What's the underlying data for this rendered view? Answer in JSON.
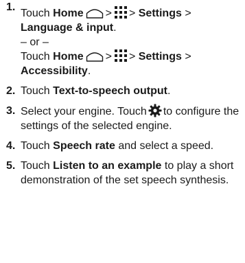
{
  "steps": [
    {
      "number": "1.",
      "touch": "Touch",
      "home": "Home",
      "sep1": ">",
      "sep2": ">",
      "settings": "Settings",
      "sep3": ">",
      "target": "Language & input",
      "end": ".",
      "or_text": "– or –",
      "alt_touch": "Touch",
      "alt_home": "Home",
      "alt_sep1": ">",
      "alt_sep2": ">",
      "alt_settings": "Settings",
      "alt_sep3": ">",
      "alt_target": "Accessibility",
      "alt_end": "."
    },
    {
      "number": "2.",
      "touch": "Touch",
      "target": "Text-to-speech output",
      "end": "."
    },
    {
      "number": "3.",
      "text_a": "Select your engine. Touch",
      "text_b": "to configure the settings of the selected engine."
    },
    {
      "number": "4.",
      "touch": "Touch",
      "target": "Speech rate",
      "rest": "and select a speed."
    },
    {
      "number": "5.",
      "touch": "Touch",
      "target": "Listen to an example",
      "rest": "to play a short demonstration of the set speech synthesis."
    }
  ],
  "icons": {
    "home": "home-icon",
    "apps": "apps-grid-icon",
    "gear": "gear-icon"
  },
  "colors": {
    "text": "#1a1a1a",
    "icon": "#1a1a1a"
  }
}
